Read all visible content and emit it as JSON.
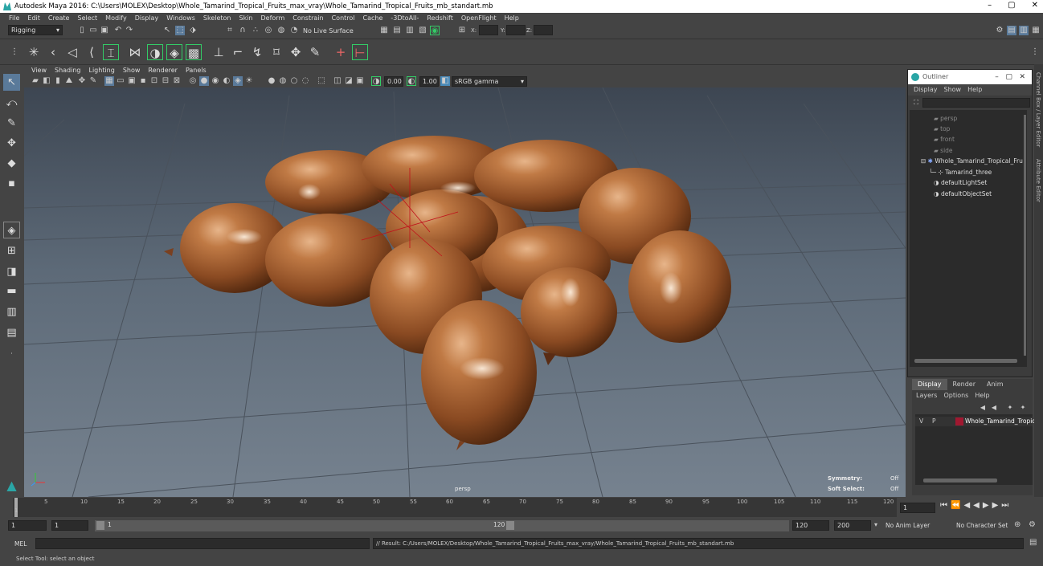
{
  "window": {
    "title": "Autodesk Maya 2016: C:\\Users\\MOLEX\\Desktop\\Whole_Tamarind_Tropical_Fruits_max_vray\\Whole_Tamarind_Tropical_Fruits_mb_standart.mb",
    "min": "–",
    "max": "▢",
    "close": "✕"
  },
  "menubar": [
    "File",
    "Edit",
    "Create",
    "Select",
    "Modify",
    "Display",
    "Windows",
    "Skeleton",
    "Skin",
    "Deform",
    "Constrain",
    "Control",
    "Cache",
    "-3DtoAll-",
    "Redshift",
    "OpenFlight",
    "Help"
  ],
  "statusline": {
    "mode": "Rigging",
    "live_surface": "No Live Surface",
    "x_label": "X:",
    "y_label": "Y:",
    "z_label": "Z:"
  },
  "viewport": {
    "menu": [
      "View",
      "Shading",
      "Lighting",
      "Show",
      "Renderer",
      "Panels"
    ],
    "near_value": "0.00",
    "far_value": "1.00",
    "color_space": "sRGB gamma",
    "camera_label": "persp",
    "symmetry_label": "Symmetry:",
    "symmetry_value": "Off",
    "soft_select_label": "Soft Select:",
    "soft_select_value": "Off"
  },
  "outliner": {
    "title": "Outliner",
    "menu": [
      "Display",
      "Show",
      "Help"
    ],
    "items": [
      "persp",
      "top",
      "front",
      "side",
      "Whole_Tamarind_Tropical_Fru",
      "Tamarind_three",
      "defaultLightSet",
      "defaultObjectSet"
    ]
  },
  "layers": {
    "tabs": [
      "Display",
      "Render",
      "Anim"
    ],
    "menu": [
      "Layers",
      "Options",
      "Help"
    ],
    "row": {
      "v": "V",
      "p": "P",
      "name": "Whole_Tamarind_Tropic"
    }
  },
  "timeline": {
    "ticks": [
      "1",
      "5",
      "10",
      "15",
      "20",
      "25",
      "30",
      "35",
      "40",
      "45",
      "50",
      "55",
      "60",
      "65",
      "70",
      "75",
      "80",
      "85",
      "90",
      "95",
      "100",
      "105",
      "110",
      "115",
      "120"
    ],
    "current_frame": "1"
  },
  "range": {
    "start": "1",
    "playback_start": "1",
    "slider_start": "1",
    "slider_end": "120",
    "playback_end": "120",
    "end": "200",
    "anim_layer": "No Anim Layer",
    "char_set": "No Character Set"
  },
  "cmdline": {
    "label": "MEL",
    "result": "// Result: C:/Users/MOLEX/Desktop/Whole_Tamarind_Tropical_Fruits_max_vray/Whole_Tamarind_Tropical_Fruits_mb_standart.mb"
  },
  "helpline": "Select Tool: select an object",
  "side_tabs": {
    "channel": "Channel Box / Layer Editor",
    "attr": "Attribute Editor"
  },
  "colors": {
    "layer_swatch": "#a01830",
    "fruit": "#b06a35"
  }
}
